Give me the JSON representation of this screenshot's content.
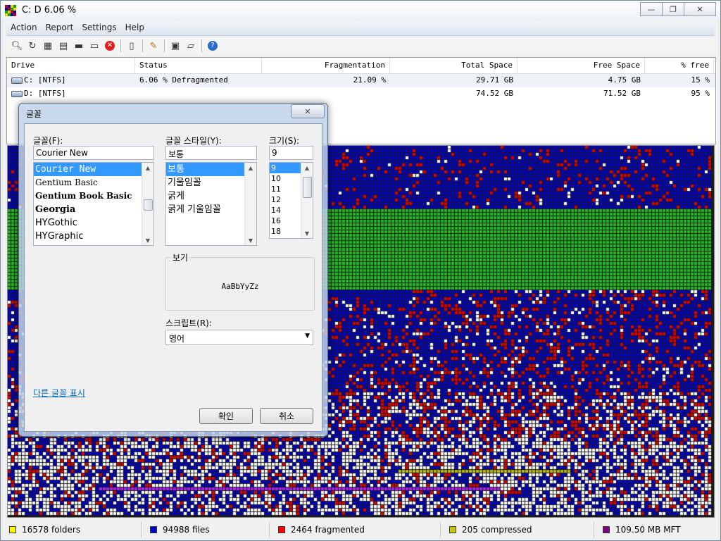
{
  "window": {
    "title": "C:  D   6.06 %",
    "minimize_glyph": "—",
    "maximize_glyph": "❐",
    "close_glyph": "✕"
  },
  "menu": [
    "Action",
    "Report",
    "Settings",
    "Help"
  ],
  "toolbar_icons": [
    "magnifier-icon",
    "refresh-icon",
    "defrag-icon",
    "optimize-icon",
    "disk-icon",
    "drive-icon",
    "stop-icon",
    "report-icon",
    "settings-icon",
    "console-icon",
    "script-icon",
    "help-icon"
  ],
  "drives": {
    "headers": [
      "Drive",
      "Status",
      "Fragmentation",
      "Total Space",
      "Free Space",
      "% free"
    ],
    "rows": [
      {
        "drive": "C: [NTFS]",
        "status": "6.06 % Defragmented",
        "fragmentation": "21.09 %",
        "total": "29.71 GB",
        "free": "4.75 GB",
        "pct": "15 %"
      },
      {
        "drive": "D: [NTFS]",
        "status": "",
        "fragmentation": "",
        "total": "74.52 GB",
        "free": "71.52 GB",
        "pct": "95 %"
      }
    ]
  },
  "status_bar": [
    {
      "text": "16578 folders",
      "color": "#ffff00"
    },
    {
      "text": "94988 files",
      "color": "#0000cc"
    },
    {
      "text": "2464 fragmented",
      "color": "#ff0000"
    },
    {
      "text": "205 compressed",
      "color": "#c8c800"
    },
    {
      "text": "109.50 MB MFT",
      "color": "#800080"
    }
  ],
  "map_colors": {
    "free": "#ffffff",
    "files": "#0000cc",
    "fragmented": "#dd0000",
    "mft": "#22bb22",
    "compressed": "#bbbb00",
    "system": "#aa22ee",
    "grid": "#1a1a1a"
  },
  "font_dialog": {
    "title": "글꼴",
    "close_glyph": "✕",
    "font_label": "글꼴(F):",
    "font_value": "Courier New",
    "fonts": [
      "Courier New",
      "Gentium Basic",
      "Gentium Book Basic",
      "Georgia",
      "HYGothic",
      "HYGraphic"
    ],
    "style_label": "글꼴 스타일(Y):",
    "style_value": "보통",
    "styles": [
      "보통",
      "기울임꼴",
      "굵게",
      "굵게 기울임꼴"
    ],
    "size_label": "크기(S):",
    "size_value": "9",
    "sizes": [
      "9",
      "10",
      "11",
      "12",
      "14",
      "16",
      "18"
    ],
    "preview_label": "보기",
    "preview_text": "AaBbYyZz",
    "script_label": "스크립트(R):",
    "script_value": "영어",
    "more_fonts_link": "다른 글꼴 표시",
    "ok": "확인",
    "cancel": "취소"
  }
}
